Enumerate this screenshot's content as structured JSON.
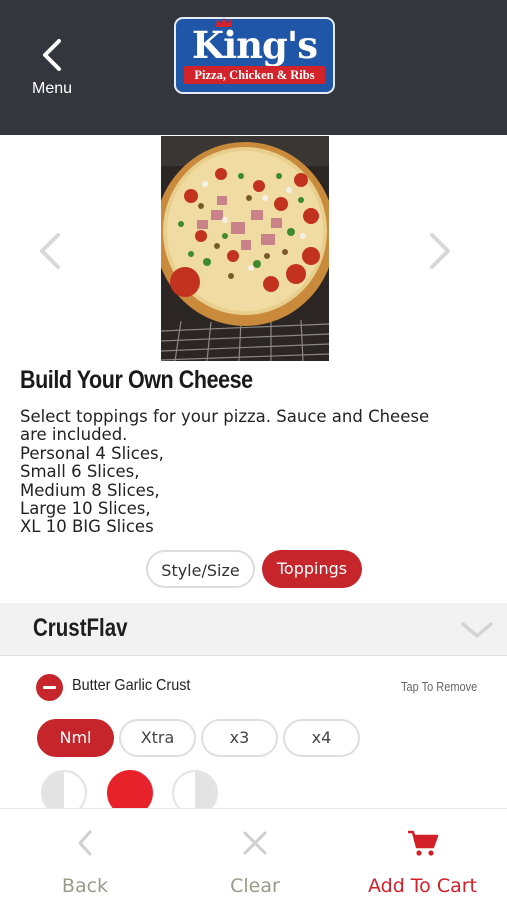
{
  "header": {
    "menu_label": "Menu",
    "logo": {
      "name": "King's",
      "tagline": "Pizza, Chicken & Ribs"
    }
  },
  "product": {
    "title": "Build Your Own Cheese",
    "description_lines": [
      "Select toppings for your pizza. Sauce and Cheese",
      "are included.",
      "Personal 4 Slices,",
      "Small 6 Slices,",
      "Medium 8 Slices,",
      "Large 10 Slices,",
      "XL 10 BIG Slices"
    ]
  },
  "tabs": [
    {
      "label": "Style/Size",
      "selected": false
    },
    {
      "label": "Toppings",
      "selected": true
    }
  ],
  "section": {
    "title": "CrustFlav",
    "item": {
      "name": "Butter Garlic Crust",
      "hint": "Tap To Remove"
    },
    "amounts": [
      {
        "label": "Nml",
        "selected": true
      },
      {
        "label": "Xtra",
        "selected": false
      },
      {
        "label": "x3",
        "selected": false
      },
      {
        "label": "x4",
        "selected": false
      }
    ]
  },
  "bottom_bar": {
    "back_label": "Back",
    "clear_label": "Clear",
    "cart_label": "Add To Cart"
  },
  "colors": {
    "header_bg": "#33363d",
    "accent": "#c6262b",
    "logo_blue": "#1f56a8",
    "muted": "#9a9a8a"
  },
  "icons": [
    "chevron-left-icon",
    "chevron-right-icon",
    "chevron-down-icon",
    "minus-circle-icon",
    "close-icon",
    "cart-icon"
  ]
}
